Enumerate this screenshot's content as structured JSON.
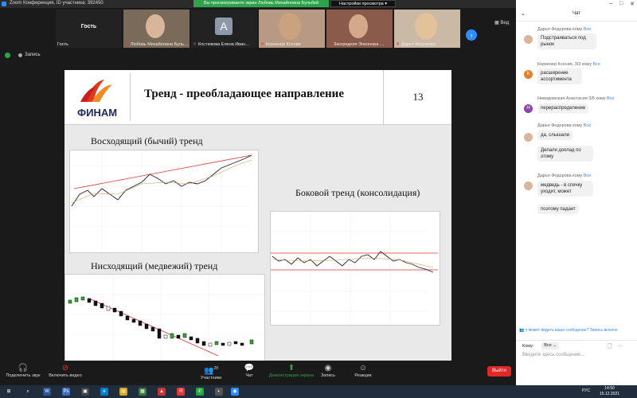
{
  "window": {
    "title": "Zoom Конференция, ID участника: 392450",
    "share_banner": "Вы просматриваете экран Любовь Михайловна Бульбей",
    "view_options": "Настройки просмотра",
    "view_label": "Вид"
  },
  "gallery": {
    "tiles": [
      {
        "name": "Гость",
        "label": "Гость"
      },
      {
        "name": "Любовь Михайловна Буль…"
      },
      {
        "name": "Костюкова Елена Иван…",
        "avatar": "A"
      },
      {
        "name": "Керкенер Ксения"
      },
      {
        "name": "Загородняя Элеонора …"
      },
      {
        "name": "Дарья Фёдорова"
      }
    ]
  },
  "recording": {
    "label": "Запись"
  },
  "slide": {
    "logo": "ФИНАМ",
    "title": "Тренд - преобладающее направление",
    "number": "13",
    "chart_titles": {
      "up": "Восходящий (бычий) тренд",
      "side": "Боковой тренд (консолидация)",
      "down": "Нисходящий (медвежий) тренд"
    }
  },
  "toolbar": {
    "audio": "Подключить звук",
    "video": "Включить видео",
    "participants": "Участники",
    "participants_count": "28",
    "chat": "Чат",
    "share": "Демонстрация экрана",
    "record": "Запись",
    "reactions": "Реакции",
    "leave": "Выйти"
  },
  "chat": {
    "title": "Чат",
    "messages": [
      {
        "sender": "Дарья Федорова",
        "to": "кому",
        "to_target": "Все",
        "lines": [
          "Подстраиваться под рынок"
        ]
      },
      {
        "sender": "Керкенер Ксения, 3/3",
        "to": "кому",
        "to_target": "Все",
        "avatar": "К",
        "avatar_color": "#e67e22",
        "lines": [
          "расширение ассортимента"
        ]
      },
      {
        "sender": "Невидомская Анастасия 3/5",
        "to": "кому",
        "to_target": "Все",
        "avatar": "Н",
        "avatar_color": "#8e44ad",
        "lines": [
          "перераспределение"
        ]
      },
      {
        "sender": "Дарья Федорова",
        "to": "кому",
        "to_target": "Все",
        "lines": [
          "да, слышали",
          "Делали доклад по этому"
        ]
      },
      {
        "sender": "Дарья Федорова",
        "to": "кому",
        "to_target": "Все",
        "lines": [
          "медведь - в спячку уходит, может",
          "поэтому падает"
        ]
      }
    ],
    "notice": "о может видеть ваше сообщение? Запись включе",
    "to_label": "Кому:",
    "to_value": "Все",
    "input_placeholder": "Введите здесь сообщение..."
  },
  "taskbar": {
    "lang": "РУС",
    "time": "14:50",
    "date": "15.12.2021"
  }
}
